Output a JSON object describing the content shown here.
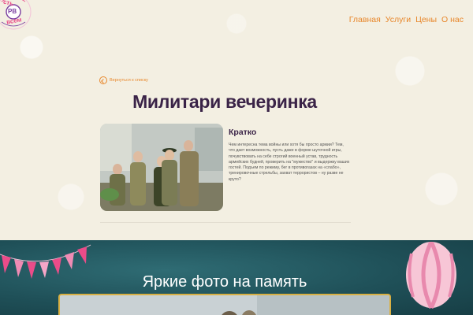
{
  "logo": {
    "text_top": "сть",
    "monogram": "РВ",
    "text_bottom": "всем"
  },
  "nav": {
    "items": [
      "Главная",
      "Услуги",
      "Цены",
      "О нас"
    ],
    "color": "#e8872b"
  },
  "back_link": {
    "label": "Вернуться к списку",
    "icon": "arrow-left-circle-icon"
  },
  "page": {
    "title": "Милитари вечеринка"
  },
  "brief": {
    "heading": "Кратко",
    "text": "Чем интересна тема войны или хотя бы просто армии? Тем, что дает возможность, пусть даже в форме шуточной игры, почувствовать на себе строгий военный устав, трудность армейских будней, проверить на \"мужество\" и выдержку ваших гостей. Подъем по режиму, бег в противогазах на «слабо», тренировочные стрельбы, захват террористов – ну разве не круто?"
  },
  "gallery_section": {
    "title": "Яркие фото на память"
  },
  "colors": {
    "accent": "#e8872b",
    "title": "#3a2347",
    "bottom_bg": "#1f5058",
    "gallery_border": "#d9b043"
  }
}
